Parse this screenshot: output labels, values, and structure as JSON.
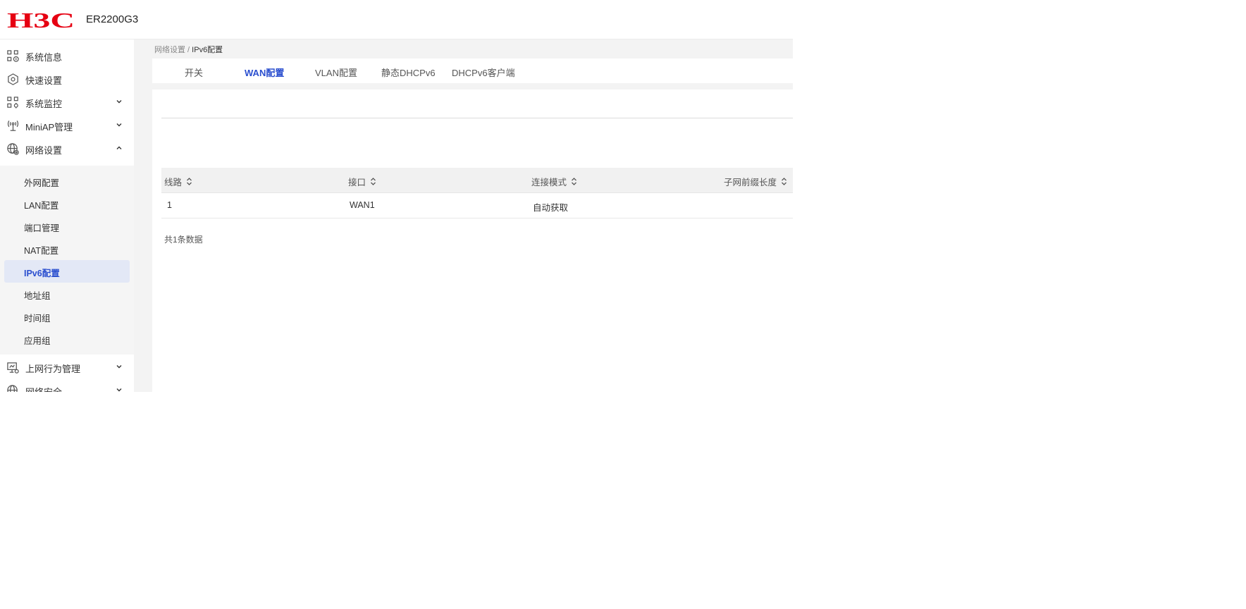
{
  "header": {
    "brand": "H3C",
    "model": "ER2200G3",
    "brand_color": "#e60012"
  },
  "sidebar": {
    "items": [
      {
        "label": "系统信息",
        "icon": "system-info-icon"
      },
      {
        "label": "快速设置",
        "icon": "quick-setup-icon"
      },
      {
        "label": "系统监控",
        "icon": "system-monitor-icon"
      },
      {
        "label": "MiniAP管理",
        "icon": "miniap-icon"
      },
      {
        "label": "网络设置",
        "icon": "network-globe-icon"
      },
      {
        "label": "上网行为管理",
        "icon": "behavior-monitor-icon"
      },
      {
        "label": "网络安全",
        "icon": "security-globe-icon"
      }
    ],
    "submenu": [
      {
        "label": "外网配置"
      },
      {
        "label": "LAN配置"
      },
      {
        "label": "端口管理"
      },
      {
        "label": "NAT配置"
      },
      {
        "label": "IPv6配置"
      },
      {
        "label": "地址组"
      },
      {
        "label": "时间组"
      },
      {
        "label": "应用组"
      }
    ],
    "active_color": "#2b4fcf"
  },
  "breadcrumb": {
    "parent": "网络设置",
    "separator": " / ",
    "current": "IPv6配置"
  },
  "tabs": [
    {
      "label": "开关"
    },
    {
      "label": "WAN配置",
      "active": true
    },
    {
      "label": "VLAN配置"
    },
    {
      "label": "静态DHCPv6"
    },
    {
      "label": "DHCPv6客户端"
    }
  ],
  "table": {
    "columns": [
      "线路",
      "接口",
      "连接模式",
      "子网前缀长度"
    ],
    "rows": [
      [
        "1",
        "WAN1",
        "自动获取",
        ""
      ]
    ],
    "total": "共1条数据"
  }
}
